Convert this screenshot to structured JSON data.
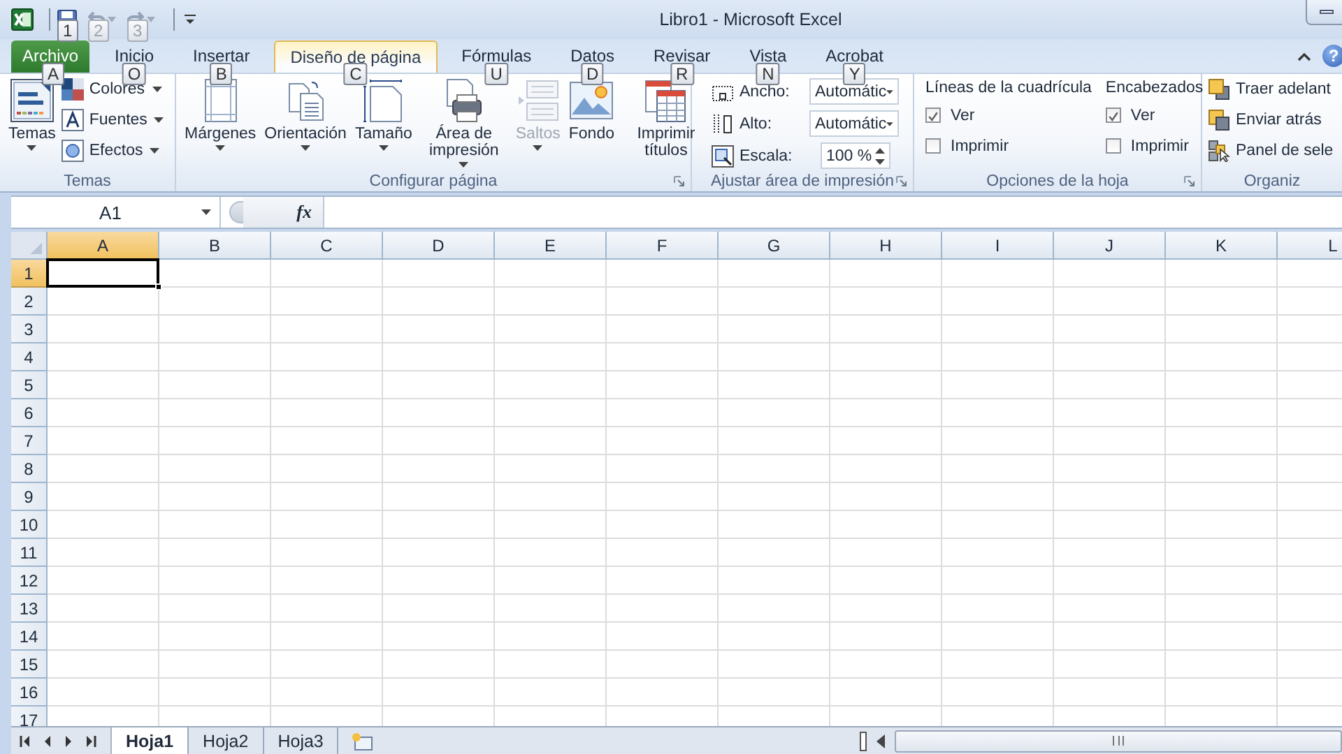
{
  "window": {
    "title": "Libro1  -  Microsoft Excel"
  },
  "quick_access": [
    {
      "keytip": "1",
      "disabled": false,
      "dropdown": false
    },
    {
      "keytip": "2",
      "disabled": true,
      "dropdown": true
    },
    {
      "keytip": "3",
      "disabled": true,
      "dropdown": true
    }
  ],
  "tabs": [
    {
      "label": "Archivo",
      "kind": "file",
      "selected": false,
      "keytip": "A"
    },
    {
      "label": "Inicio",
      "kind": "tab",
      "selected": false,
      "keytip": "O"
    },
    {
      "label": "Insertar",
      "kind": "tab",
      "selected": false,
      "keytip": "B"
    },
    {
      "label": "Diseño de página",
      "kind": "tab",
      "selected": true,
      "keytip": "C"
    },
    {
      "label": "Fórmulas",
      "kind": "tab",
      "selected": false,
      "keytip": "U"
    },
    {
      "label": "Datos",
      "kind": "tab",
      "selected": false,
      "keytip": "D"
    },
    {
      "label": "Revisar",
      "kind": "tab",
      "selected": false,
      "keytip": "R"
    },
    {
      "label": "Vista",
      "kind": "tab",
      "selected": false,
      "keytip": "N"
    },
    {
      "label": "Acrobat",
      "kind": "tab",
      "selected": false,
      "keytip": "Y"
    }
  ],
  "help": "?",
  "ribbon": [
    {
      "kind": "themes",
      "label": "Temas",
      "launcher": false,
      "large": [
        {
          "label": "Temas",
          "dropdown": true,
          "disabled": false
        }
      ],
      "small": [
        {
          "label": "Colores",
          "dropdown": true
        },
        {
          "label": "Fuentes",
          "dropdown": true
        },
        {
          "label": "Efectos",
          "dropdown": true
        }
      ]
    },
    {
      "kind": "page_setup",
      "label": "Configurar página",
      "launcher": true,
      "large": [
        {
          "label": "Márgenes",
          "dropdown": true,
          "disabled": false
        },
        {
          "label": "Orientación",
          "dropdown": true,
          "disabled": false
        },
        {
          "label": "Tamaño",
          "dropdown": true,
          "disabled": false
        },
        {
          "label": "Área de impresión",
          "dropdown": true,
          "disabled": false
        },
        {
          "label": "Saltos",
          "dropdown": true,
          "disabled": true
        },
        {
          "label": "Fondo",
          "dropdown": false,
          "disabled": false
        },
        {
          "label": "Imprimir títulos",
          "dropdown": false,
          "disabled": false
        }
      ]
    },
    {
      "kind": "scale",
      "label": "Ajustar área de impresión",
      "launcher": true,
      "fields": [
        {
          "label": "Ancho:",
          "value": "Automátic",
          "kind": "select"
        },
        {
          "label": "Alto:",
          "value": "Automátic",
          "kind": "select"
        },
        {
          "label": "Escala:",
          "value": "100 %",
          "kind": "spin"
        }
      ]
    },
    {
      "kind": "options",
      "label": "Opciones de la hoja",
      "launcher": true,
      "sections": [
        {
          "heading": "Líneas de la cuadrícula",
          "checks": [
            {
              "label": "Ver",
              "checked": true
            },
            {
              "label": "Imprimir",
              "checked": false
            }
          ]
        },
        {
          "heading": "Encabezados",
          "checks": [
            {
              "label": "Ver",
              "checked": true
            },
            {
              "label": "Imprimir",
              "checked": false
            }
          ]
        }
      ]
    },
    {
      "kind": "arrange",
      "label": "Organiz",
      "launcher": false,
      "small": [
        {
          "label": "Traer adelant",
          "dropdown": false
        },
        {
          "label": "Enviar atrás",
          "dropdown": false
        },
        {
          "label": "Panel de sele",
          "dropdown": false
        }
      ]
    }
  ],
  "formula_bar": {
    "name_box": "A1",
    "function_label": "fx"
  },
  "grid": {
    "columns": [
      {
        "label": "A",
        "selected": true
      },
      {
        "label": "B",
        "selected": false
      },
      {
        "label": "C",
        "selected": false
      },
      {
        "label": "D",
        "selected": false
      },
      {
        "label": "E",
        "selected": false
      },
      {
        "label": "F",
        "selected": false
      },
      {
        "label": "G",
        "selected": false
      },
      {
        "label": "H",
        "selected": false
      },
      {
        "label": "I",
        "selected": false
      },
      {
        "label": "J",
        "selected": false
      },
      {
        "label": "K",
        "selected": false
      },
      {
        "label": "L",
        "selected": false
      }
    ],
    "rows": [
      {
        "label": "1",
        "selected": true
      },
      {
        "label": "2",
        "selected": false
      },
      {
        "label": "3",
        "selected": false
      },
      {
        "label": "4",
        "selected": false
      },
      {
        "label": "5",
        "selected": false
      },
      {
        "label": "6",
        "selected": false
      },
      {
        "label": "7",
        "selected": false
      },
      {
        "label": "8",
        "selected": false
      },
      {
        "label": "9",
        "selected": false
      },
      {
        "label": "10",
        "selected": false
      },
      {
        "label": "11",
        "selected": false
      },
      {
        "label": "12",
        "selected": false
      },
      {
        "label": "13",
        "selected": false
      },
      {
        "label": "14",
        "selected": false
      },
      {
        "label": "15",
        "selected": false
      },
      {
        "label": "16",
        "selected": false
      },
      {
        "label": "17",
        "selected": false
      }
    ]
  },
  "sheets": [
    {
      "label": "Hoja1",
      "selected": true
    },
    {
      "label": "Hoja2",
      "selected": false
    },
    {
      "label": "Hoja3",
      "selected": false
    }
  ]
}
